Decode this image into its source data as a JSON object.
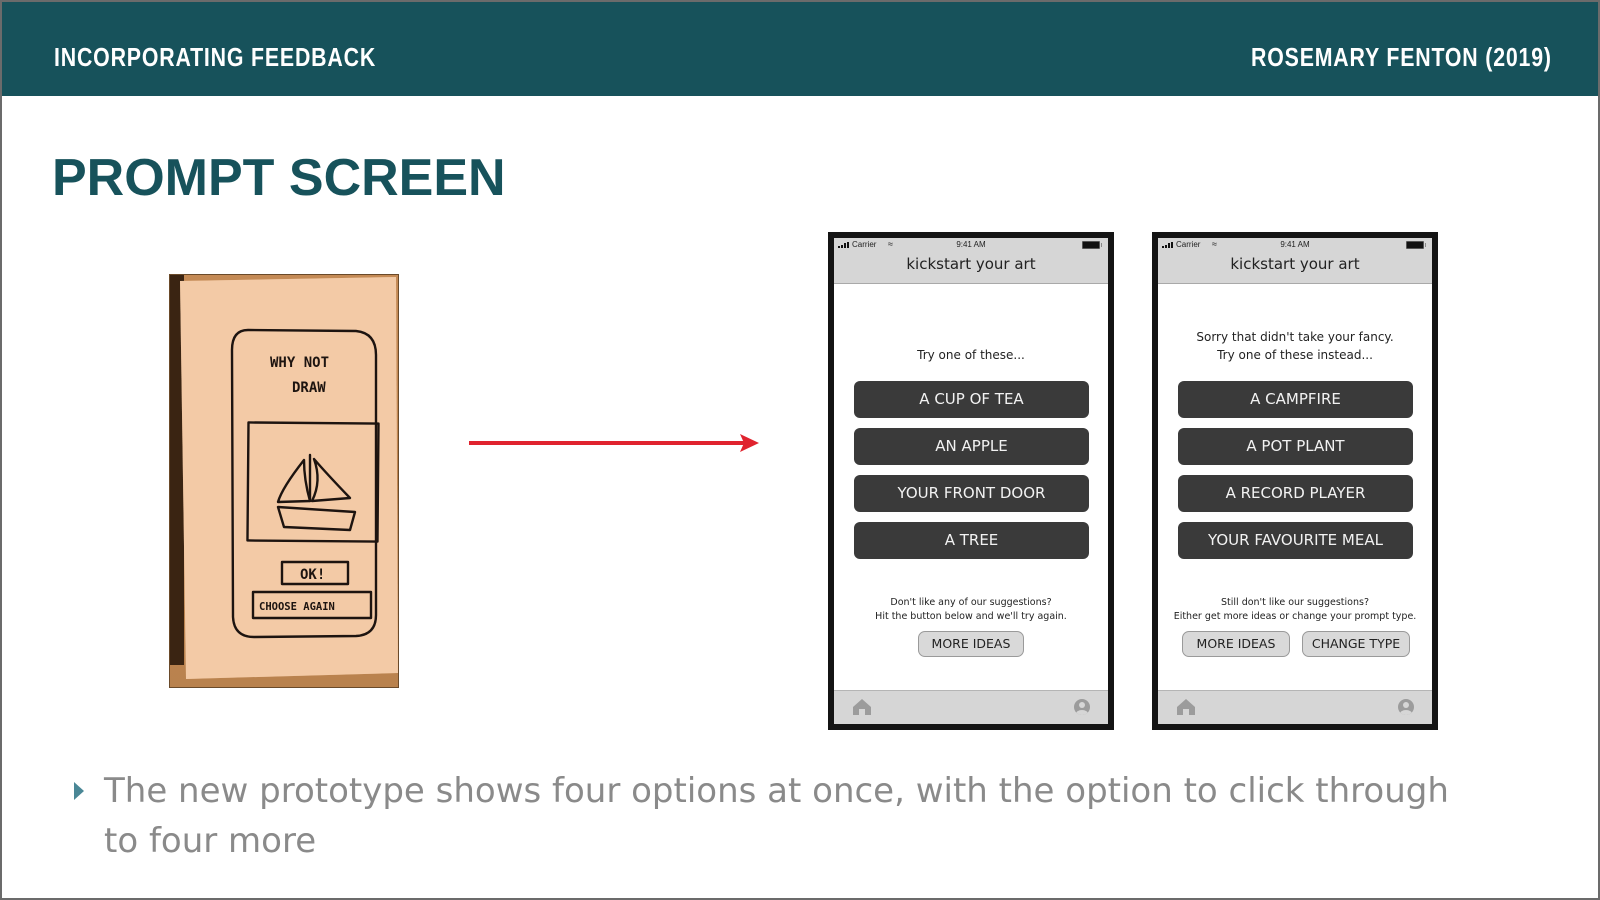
{
  "header": {
    "section": "INCORPORATING FEEDBACK",
    "author": "ROSEMARY FENTON (2019)"
  },
  "slide_title": "PROMPT SCREEN",
  "paper_prototype": {
    "title_line1": "WHY NOT",
    "title_line2": "DRAW",
    "ok_label": "OK!",
    "choose_again_label": "CHOOSE AGAIN"
  },
  "colors": {
    "brand": "#17525b",
    "arrow": "#e0232e",
    "option_button": "#3a3a3a",
    "bullet": "#4a8796"
  },
  "phones": [
    {
      "status": {
        "carrier": "Carrier",
        "time": "9:41 AM"
      },
      "app_title": "kickstart your art",
      "intro_lines": [
        "Try one of these..."
      ],
      "options": [
        "A CUP OF TEA",
        "AN APPLE",
        "YOUR FRONT DOOR",
        "A TREE"
      ],
      "hint_lines": [
        "Don't like any of our suggestions?",
        "Hit the button below and we'll try again."
      ],
      "secondary_buttons": [
        "MORE IDEAS"
      ],
      "tabbar": {
        "left_icon": "home-icon",
        "right_icon": "user-icon"
      }
    },
    {
      "status": {
        "carrier": "Carrier",
        "time": "9:41 AM"
      },
      "app_title": "kickstart your art",
      "intro_lines": [
        "Sorry that didn't take your fancy.",
        "Try one of these instead..."
      ],
      "options": [
        "A CAMPFIRE",
        "A POT PLANT",
        "A RECORD PLAYER",
        "YOUR FAVOURITE MEAL"
      ],
      "hint_lines": [
        "Still don't like our suggestions?",
        "Either get more ideas or change your prompt type."
      ],
      "secondary_buttons": [
        "MORE IDEAS",
        "CHANGE TYPE"
      ],
      "tabbar": {
        "left_icon": "home-icon",
        "right_icon": "user-icon"
      }
    }
  ],
  "bullets": [
    "The new prototype shows four options at once, with the option to click through to four more"
  ]
}
